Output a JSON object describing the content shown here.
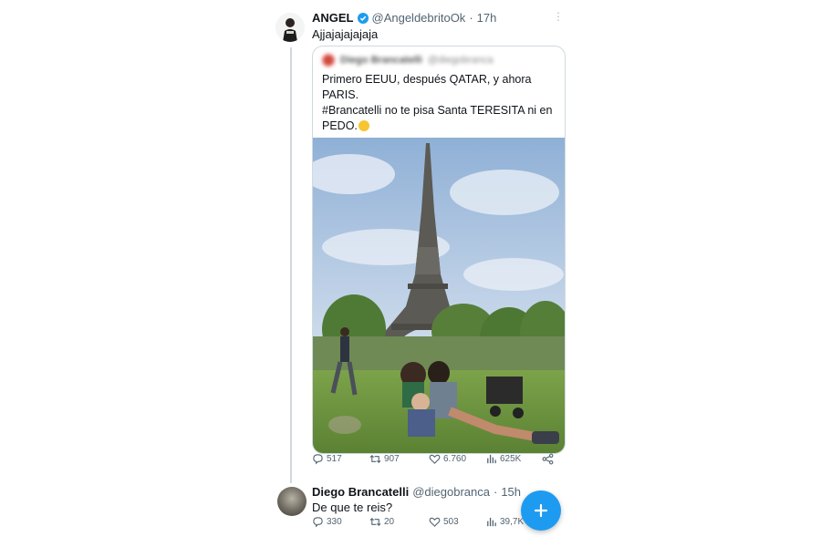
{
  "tweet_main": {
    "name": "ANGEL",
    "handle": "@AngeldebritoOk",
    "separator": "·",
    "time": "17h",
    "text": "Ajjajajajajaja",
    "stats": {
      "replies": "517",
      "retweets": "907",
      "likes": "6.760",
      "views": "625K"
    }
  },
  "quoted_tweet": {
    "author_name": "Diego Brancatelli",
    "author_handle": "@diegobranca",
    "lines": [
      "Primero EEUU, después QATAR, y ahora",
      "PARIS.",
      "#Brancatelli no te pisa Santa TERESITA ni en",
      "PEDO."
    ],
    "emoji": "smirk-emoji",
    "photo_description_icon": "eiffel-tower-photo"
  },
  "reply": {
    "name": "Diego Brancatelli",
    "handle": "@diegobranca",
    "separator": "·",
    "time": "15h",
    "text": "De que te reis?",
    "stats": {
      "replies": "330",
      "retweets": "20",
      "likes": "503",
      "views": "39,7K"
    }
  },
  "icons": {
    "reply": "reply-icon",
    "retweet": "retweet-icon",
    "like": "heart-icon",
    "views": "views-icon",
    "share": "share-icon",
    "compose": "compose-plus-icon",
    "verified": "verified-badge-icon"
  },
  "colors": {
    "accent": "#1d9bf0",
    "text_primary": "#0f1419",
    "text_secondary": "#536471",
    "border": "#cfd9de"
  }
}
